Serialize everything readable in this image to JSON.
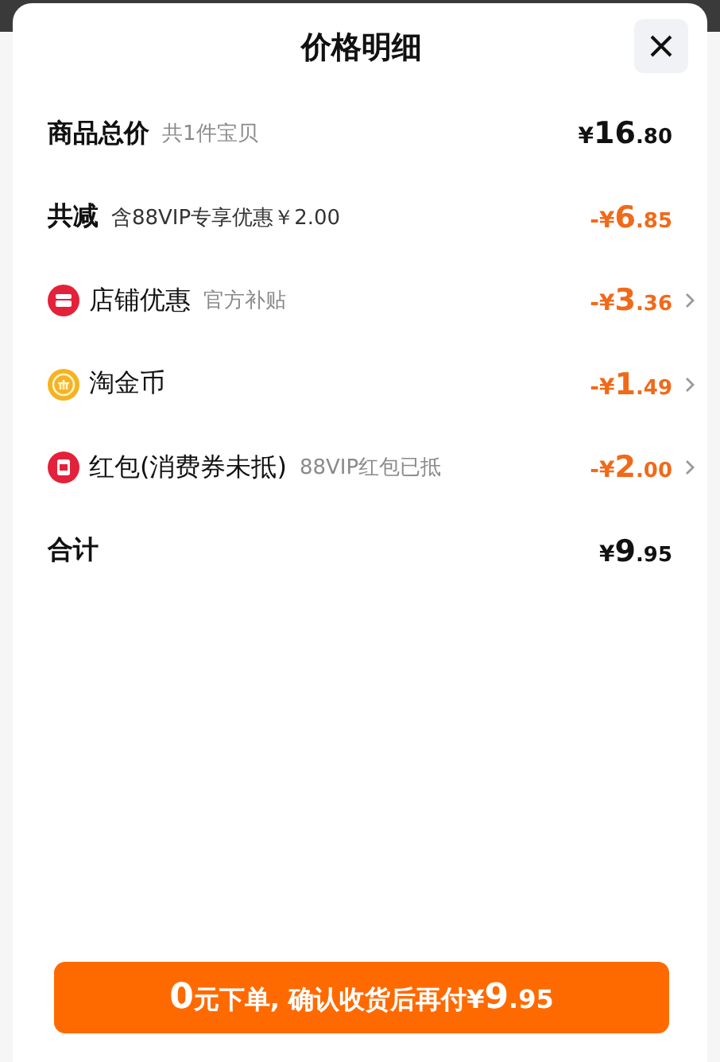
{
  "sheet": {
    "title": "价格明细"
  },
  "rows": [
    {
      "kind": "summary",
      "label": "商品总价",
      "note": "共1件宝贝",
      "amount": {
        "currency": "¥",
        "whole": "16",
        "cents": ".80"
      },
      "discount": false,
      "expandable": false
    },
    {
      "kind": "summary",
      "label": "共减",
      "note": "含88VIP专享优惠￥2.00",
      "amount": {
        "currency": "-¥",
        "whole": "6",
        "cents": ".85"
      },
      "discount": true,
      "expandable": false
    },
    {
      "kind": "shop",
      "label": "店铺优惠",
      "note": "官方补贴",
      "amount": {
        "currency": "-¥",
        "whole": "3",
        "cents": ".36"
      },
      "discount": true,
      "expandable": true
    },
    {
      "kind": "coin",
      "label": "淘金币",
      "amount": {
        "currency": "-¥",
        "whole": "1",
        "cents": ".49"
      },
      "discount": true,
      "expandable": true
    },
    {
      "kind": "packet",
      "label": "红包(消费券未抵)",
      "note": "88VIP红包已抵",
      "amount": {
        "currency": "-¥",
        "whole": "2",
        "cents": ".00"
      },
      "discount": true,
      "expandable": true
    },
    {
      "kind": "total",
      "label": "合计",
      "amount": {
        "currency": "¥",
        "whole": "9",
        "cents": ".95"
      },
      "discount": false,
      "expandable": false
    }
  ],
  "pay_button": {
    "lead": "0",
    "text": "元下单, 确认收货后再付",
    "currency": "¥",
    "whole": "9",
    "cents": ".95"
  }
}
